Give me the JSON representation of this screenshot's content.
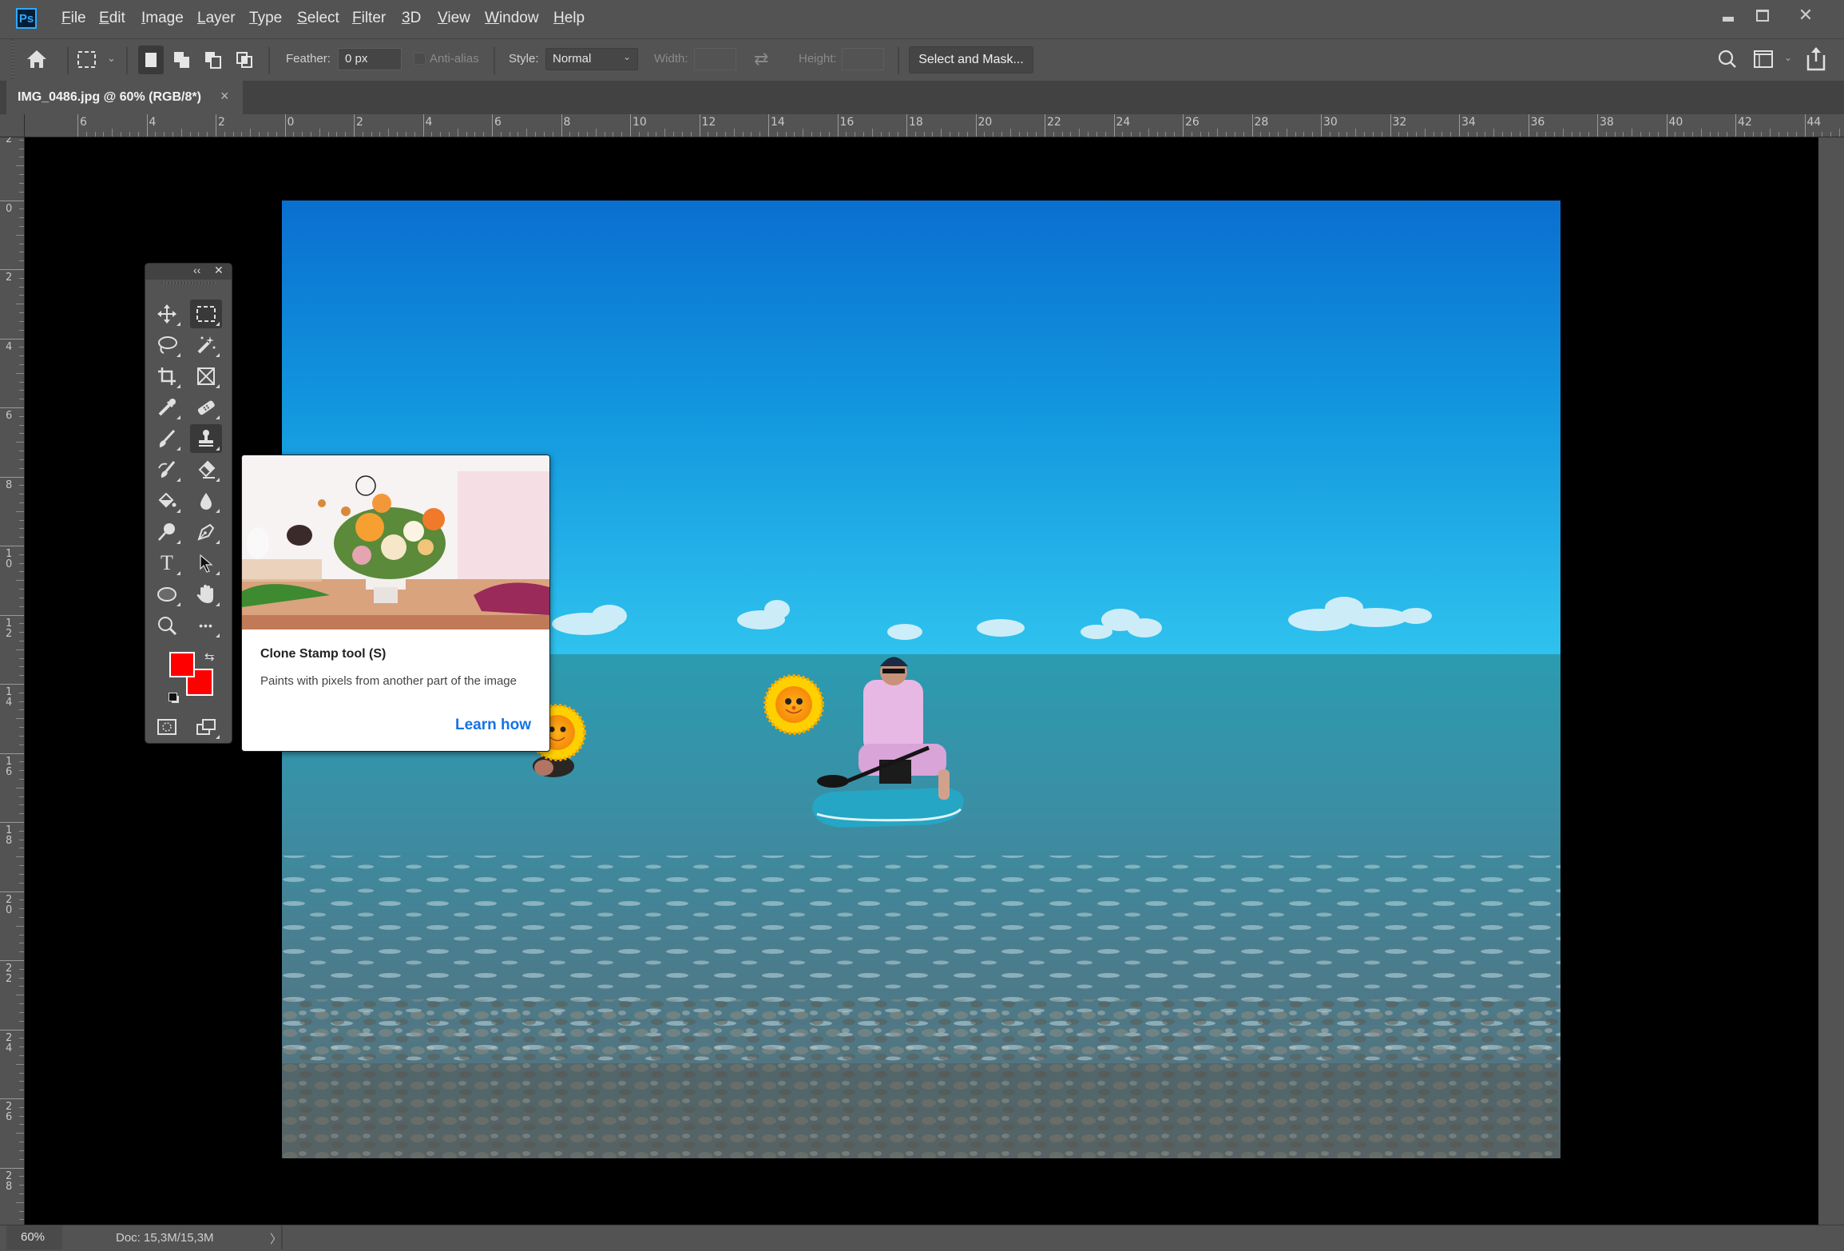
{
  "app": {
    "logo": "Ps",
    "name": "Adobe Photoshop"
  },
  "menu": {
    "items": [
      "File",
      "Edit",
      "Image",
      "Layer",
      "Type",
      "Select",
      "Filter",
      "3D",
      "View",
      "Window",
      "Help"
    ]
  },
  "window_controls": {
    "minimize": "minimize-icon",
    "maximize": "maximize-icon",
    "close": "close-icon"
  },
  "options_bar": {
    "home_icon": "home-icon",
    "tool_preset_icon": "rectangular-marquee-icon",
    "selection_modes": [
      "new-selection",
      "add-to-selection",
      "subtract-from-selection",
      "intersect-with-selection"
    ],
    "active_mode": "new-selection",
    "feather_label": "Feather:",
    "feather_value": "0 px",
    "antialias_label": "Anti-alias",
    "antialias_checked": false,
    "style_label": "Style:",
    "style_value": "Normal",
    "width_label": "Width:",
    "width_value": "",
    "swap_icon": "swap-arrows-icon",
    "height_label": "Height:",
    "height_value": "",
    "select_and_mask_label": "Select and Mask...",
    "right_icons": [
      "search-icon",
      "workspace-icon",
      "share-icon"
    ]
  },
  "document_tab": {
    "title": "IMG_0486.jpg @ 60% (RGB/8*)",
    "close": "×"
  },
  "rulers": {
    "top_labels": [
      "6",
      "4",
      "2",
      "0",
      "2",
      "4",
      "6",
      "8",
      "10",
      "12",
      "14",
      "16",
      "18",
      "20",
      "22",
      "24",
      "26",
      "28",
      "30",
      "32",
      "34",
      "36",
      "38",
      "40",
      "42",
      "44"
    ],
    "left_labels": [
      "2",
      "0",
      "2",
      "4",
      "6",
      "8",
      "10",
      "12",
      "14",
      "16",
      "18",
      "20",
      "22",
      "24",
      "26",
      "28"
    ]
  },
  "toolbar": {
    "collapse_label": "‹‹",
    "close_label": "✕",
    "tools": [
      {
        "name": "move-tool",
        "active": false
      },
      {
        "name": "rectangular-marquee-tool",
        "active": true
      },
      {
        "name": "lasso-tool",
        "active": false
      },
      {
        "name": "magic-wand-tool",
        "active": false
      },
      {
        "name": "crop-tool",
        "active": false
      },
      {
        "name": "frame-tool",
        "active": false
      },
      {
        "name": "eyedropper-tool",
        "active": false
      },
      {
        "name": "spot-healing-brush-tool",
        "active": false
      },
      {
        "name": "brush-tool",
        "active": false
      },
      {
        "name": "clone-stamp-tool",
        "active": true
      },
      {
        "name": "history-brush-tool",
        "active": false
      },
      {
        "name": "eraser-tool",
        "active": false
      },
      {
        "name": "paint-bucket-tool",
        "active": false
      },
      {
        "name": "blur-tool",
        "active": false
      },
      {
        "name": "dodge-tool",
        "active": false
      },
      {
        "name": "pen-tool",
        "active": false
      },
      {
        "name": "type-tool",
        "active": false,
        "glyph": "T"
      },
      {
        "name": "path-selection-tool",
        "active": false
      },
      {
        "name": "ellipse-tool",
        "active": false
      },
      {
        "name": "hand-tool",
        "active": false
      },
      {
        "name": "zoom-tool",
        "active": false
      },
      {
        "name": "edit-toolbar",
        "active": false,
        "glyph": "•••"
      }
    ],
    "foreground_color": "#ff0000",
    "background_color": "#ff0000"
  },
  "tooltip": {
    "title": "Clone Stamp tool (S)",
    "description": "Paints with pixels from another part of the image",
    "link": "Learn how",
    "link_color": "#1473e6"
  },
  "status_bar": {
    "zoom": "60%",
    "doc_info": "Doc: 15,3M/15,3M",
    "expand": "〉"
  }
}
